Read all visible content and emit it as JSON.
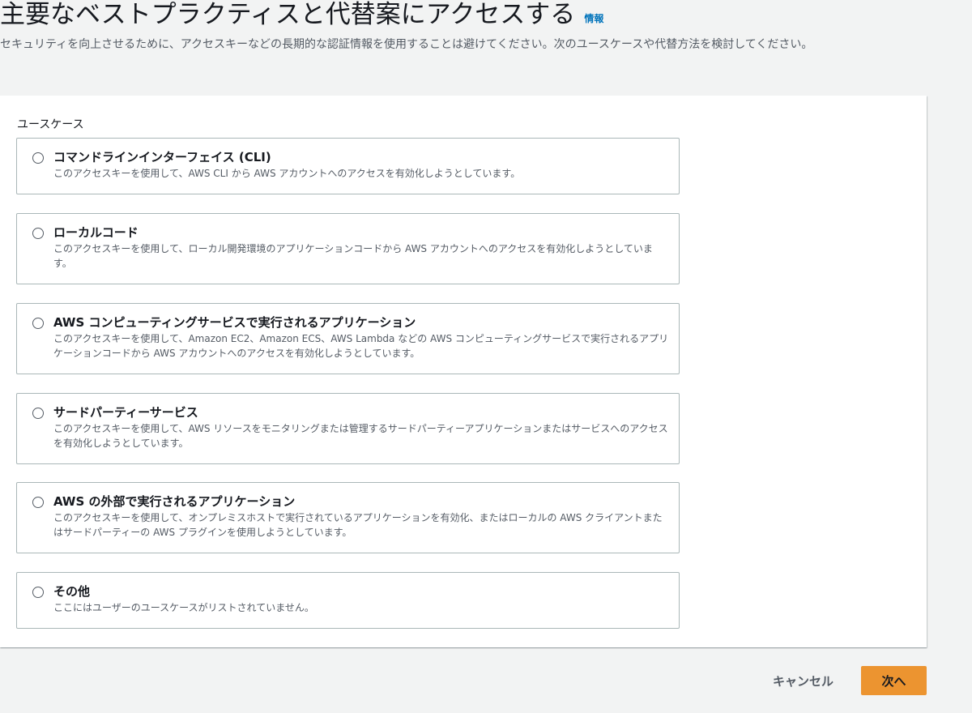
{
  "header": {
    "title": "主要なベストプラクティスと代替案にアクセスする",
    "info_link": "情報",
    "description": "セキュリティを向上させるために、アクセスキーなどの長期的な認証情報を使用することは避けてください。次のユースケースや代替方法を検討してください。"
  },
  "use_case": {
    "label": "ユースケース",
    "selected": null,
    "options": [
      {
        "title": "コマンドラインインターフェイス (CLI)",
        "description": "このアクセスキーを使用して、AWS CLI から AWS アカウントへのアクセスを有効化しようとしています。"
      },
      {
        "title": "ローカルコード",
        "description": "このアクセスキーを使用して、ローカル開発環境のアプリケーションコードから AWS アカウントへのアクセスを有効化しようとしています。"
      },
      {
        "title": "AWS コンピューティングサービスで実行されるアプリケーション",
        "description": "このアクセスキーを使用して、Amazon EC2、Amazon ECS、AWS Lambda などの AWS コンピューティングサービスで実行されるアプリケーションコードから AWS アカウントへのアクセスを有効化しようとしています。"
      },
      {
        "title": "サードパーティーサービス",
        "description": "このアクセスキーを使用して、AWS リソースをモニタリングまたは管理するサードパーティーアプリケーションまたはサービスへのアクセスを有効化しようとしています。"
      },
      {
        "title": "AWS の外部で実行されるアプリケーション",
        "description": "このアクセスキーを使用して、オンプレミスホストで実行されているアプリケーションを有効化、またはローカルの AWS クライアントまたはサードパーティーの AWS プラグインを使用しようとしています。"
      },
      {
        "title": "その他",
        "description": "ここにはユーザーのユースケースがリストされていません。"
      }
    ]
  },
  "actions": {
    "cancel_label": "キャンセル",
    "next_label": "次へ"
  },
  "colors": {
    "page_background": "#f2f3f3",
    "primary_button": "#ec9430",
    "link": "#0073bb",
    "border": "#aab7b8"
  }
}
